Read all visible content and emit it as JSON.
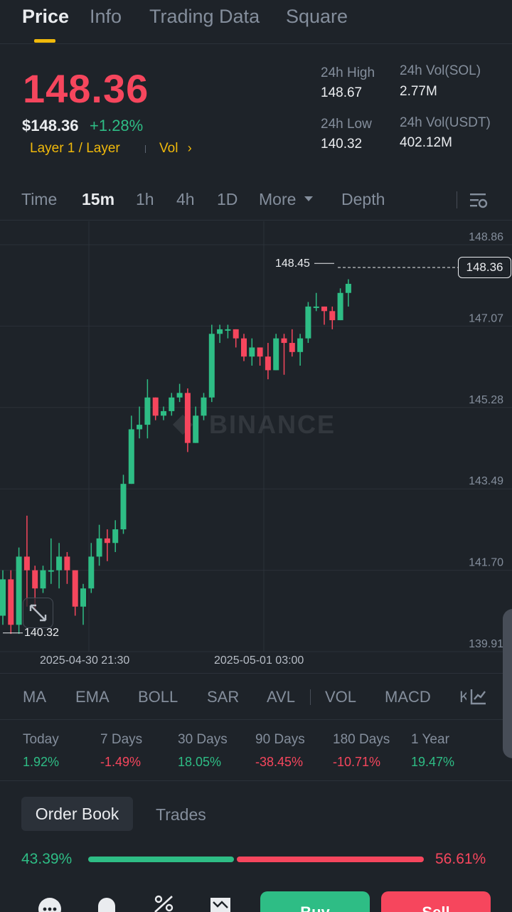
{
  "tabs": [
    "Price",
    "Info",
    "Trading Data",
    "Square"
  ],
  "header": {
    "price": "148.36",
    "price_usd": "$148.36",
    "change": "+1.28%",
    "tags": "Layer 1 / Layer",
    "vol_link": "Vol",
    "high_label": "24h High",
    "high_value": "148.67",
    "low_label": "24h Low",
    "low_value": "140.32",
    "vol_sol_label": "24h Vol(SOL)",
    "vol_sol_value": "2.77M",
    "vol_usdt_label": "24h Vol(USDT)",
    "vol_usdt_value": "402.12M"
  },
  "intervals": [
    "Time",
    "15m",
    "1h",
    "4h",
    "1D",
    "More",
    "Depth"
  ],
  "chart": {
    "watermark": "BINANCE",
    "y_ticks": [
      "148.86",
      "147.07",
      "145.28",
      "143.49",
      "141.70",
      "139.91"
    ],
    "current_price": "148.36",
    "high_marker": "148.45",
    "low_marker": "140.32",
    "x_ticks": [
      "2025-04-30 21:30",
      "2025-05-01 03:00"
    ]
  },
  "chart_data": {
    "type": "candlestick",
    "ylim": [
      139.91,
      148.86
    ],
    "candles": [
      [
        140.7,
        141.5,
        140.5,
        141.7
      ],
      [
        141.5,
        140.5,
        140.3,
        141.7
      ],
      [
        140.5,
        142.0,
        140.3,
        142.2
      ],
      [
        142.0,
        141.7,
        140.9,
        142.9
      ],
      [
        141.7,
        141.3,
        140.8,
        141.8
      ],
      [
        141.3,
        141.7,
        141.2,
        141.8
      ],
      [
        141.7,
        141.7,
        141.4,
        142.4
      ],
      [
        141.7,
        142.0,
        141.3,
        142.3
      ],
      [
        142.0,
        141.7,
        141.4,
        142.1
      ],
      [
        141.7,
        140.9,
        140.7,
        141.7
      ],
      [
        140.9,
        141.3,
        140.5,
        141.4
      ],
      [
        141.3,
        142.0,
        141.2,
        142.3
      ],
      [
        142.0,
        142.4,
        141.8,
        142.7
      ],
      [
        142.4,
        142.3,
        141.9,
        142.6
      ],
      [
        142.3,
        142.6,
        142.1,
        142.8
      ],
      [
        142.6,
        143.6,
        142.5,
        143.8
      ],
      [
        143.6,
        144.8,
        143.6,
        145.1
      ],
      [
        144.8,
        144.9,
        144.6,
        145.3
      ],
      [
        144.9,
        145.5,
        144.6,
        145.9
      ],
      [
        145.5,
        145.1,
        145.0,
        145.5
      ],
      [
        145.1,
        145.2,
        145.0,
        145.3
      ],
      [
        145.2,
        145.5,
        145.1,
        145.6
      ],
      [
        145.5,
        145.6,
        145.4,
        145.8
      ],
      [
        145.6,
        144.5,
        144.3,
        145.7
      ],
      [
        144.5,
        145.1,
        144.5,
        145.3
      ],
      [
        145.1,
        145.5,
        145.0,
        145.6
      ],
      [
        145.5,
        146.9,
        145.4,
        147.1
      ],
      [
        146.9,
        147.0,
        146.7,
        147.1
      ],
      [
        147.0,
        147.0,
        146.8,
        147.1
      ],
      [
        147.0,
        146.8,
        146.6,
        147.0
      ],
      [
        146.8,
        146.4,
        146.3,
        146.9
      ],
      [
        146.4,
        146.6,
        146.2,
        146.8
      ],
      [
        146.6,
        146.4,
        146.2,
        146.6
      ],
      [
        146.4,
        146.1,
        145.9,
        146.7
      ],
      [
        146.1,
        146.8,
        146.1,
        146.9
      ],
      [
        146.8,
        146.7,
        146.0,
        146.9
      ],
      [
        146.7,
        146.5,
        146.4,
        147.0
      ],
      [
        146.5,
        146.8,
        146.2,
        146.9
      ],
      [
        146.8,
        147.5,
        146.7,
        147.6
      ],
      [
        147.5,
        147.5,
        147.4,
        147.8
      ],
      [
        147.5,
        147.4,
        147.1,
        147.5
      ],
      [
        147.4,
        147.2,
        147.0,
        147.5
      ],
      [
        147.2,
        147.8,
        147.2,
        147.9
      ],
      [
        147.8,
        148.0,
        147.5,
        148.1
      ]
    ]
  },
  "indicators": [
    "MA",
    "EMA",
    "BOLL",
    "SAR",
    "AVL",
    "VOL",
    "MACD",
    "K"
  ],
  "performance": [
    {
      "label": "Today",
      "value": "1.92%",
      "dir": "up"
    },
    {
      "label": "7 Days",
      "value": "-1.49%",
      "dir": "down"
    },
    {
      "label": "30 Days",
      "value": "18.05%",
      "dir": "up"
    },
    {
      "label": "90 Days",
      "value": "-38.45%",
      "dir": "down"
    },
    {
      "label": "180 Days",
      "value": "-10.71%",
      "dir": "down"
    },
    {
      "label": "1 Year",
      "value": "19.47%",
      "dir": "up"
    }
  ],
  "orderbook": {
    "tab_active": "Order Book",
    "tab_other": "Trades",
    "buy_ratio": "43.39%",
    "sell_ratio": "56.61%",
    "buy_fraction": 0.4339
  },
  "actions": {
    "buy": "Buy",
    "sell": "Sell"
  },
  "colors": {
    "up": "#2ebd85",
    "down": "#f6465d",
    "accent": "#f0b90b",
    "bg": "#1e2329"
  }
}
